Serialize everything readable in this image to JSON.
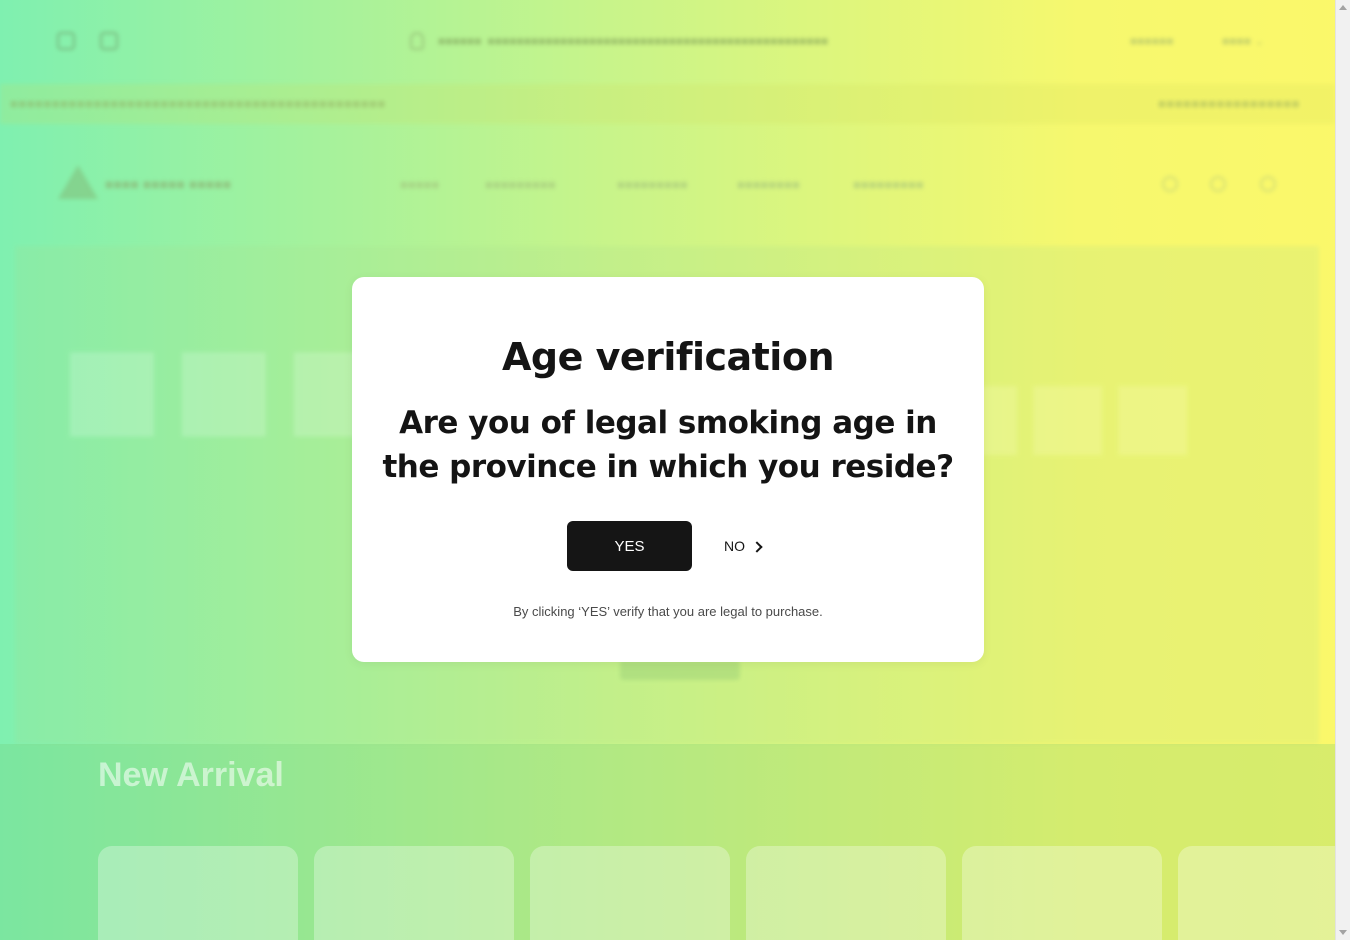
{
  "modal": {
    "title": "Age verification",
    "question": "Are you of legal smoking age in the province in which you reside?",
    "yes_label": "YES",
    "no_label": "NO",
    "disclaimer": "By clicking ‘YES’ verify that you are legal to purchase."
  },
  "background": {
    "new_arrival_heading": "New Arrival"
  },
  "colors": {
    "overlay_start": "#7ff0b0",
    "overlay_end": "#fbf86a",
    "button_dark": "#151515",
    "modal_bg": "#ffffff"
  }
}
